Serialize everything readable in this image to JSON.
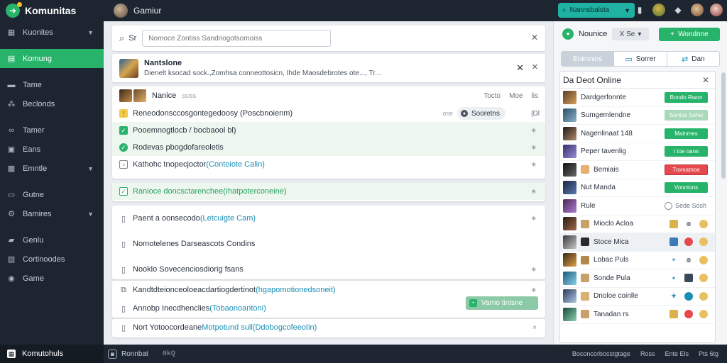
{
  "app": {
    "name": "Komunitas",
    "game_title": "Gamiur"
  },
  "sidebar": {
    "items": [
      {
        "label": "Kuonites",
        "icon": "grid-icon",
        "chevron": true
      },
      {
        "label": "Komung",
        "icon": "list-icon",
        "active": true
      },
      {
        "label": "Tame",
        "icon": "bookmark-icon"
      },
      {
        "label": "Beclonds",
        "icon": "people-icon"
      },
      {
        "label": "Tamer",
        "icon": "link-icon"
      },
      {
        "label": "Eans",
        "icon": "calendar-icon"
      },
      {
        "label": "Emntle",
        "icon": "calendar-check-icon",
        "chevron": true
      },
      {
        "label": "Gutne",
        "icon": "folder-icon"
      },
      {
        "label": "Bamires",
        "icon": "gear-icon",
        "chevron": true
      },
      {
        "label": "Genlu",
        "icon": "image-icon"
      },
      {
        "label": "Cortinoodes",
        "icon": "tag-icon"
      },
      {
        "label": "Game",
        "icon": "globe-icon"
      }
    ],
    "footer_label": "Komutohuls"
  },
  "topbar": {
    "search_pill_label": "Nannsbalsta",
    "icons": [
      "trophy-icon",
      "pin-icon",
      "bell-icon"
    ]
  },
  "filter": {
    "label": "Sr",
    "input_placeholder": "Nomoce Zontiss Sandnogotsomoiss"
  },
  "game_card": {
    "title": "Nantslone",
    "description": "Dienelt ksocad sock.,Zomhsa conneottosicn, Ihde Maosdebrotes ote..., Tr..."
  },
  "thread": {
    "name": "Nanice",
    "sub": "ssiss",
    "meta": [
      "Tocto",
      "Moe",
      "lis"
    ],
    "rows": [
      {
        "mark": "warn",
        "text": "Reneodonsccosgontegedoosy (Poscbnoienm)",
        "chip_left": "ose",
        "chip_label": "Sooretns",
        "chip_right": "|Dl"
      },
      {
        "mark": "ok",
        "text": "Pooemnogtlocb / bocbaool bl)",
        "right": "∗"
      },
      {
        "mark": "okr",
        "text": "Rodevas pbogdofareoletis",
        "right": "∗"
      },
      {
        "mark": "box",
        "text": "Kathohc tnopecjoctor ",
        "link": "(Contoiote Calin)",
        "right": "∗"
      },
      {
        "mark": "gbox",
        "text": "Ranioce doncsctarenchee ",
        "glink": "(Ihatpoterconeine)",
        "right": "∗"
      }
    ]
  },
  "list": {
    "rows": [
      {
        "text": "Paent a oonsecodo ",
        "link": "(Letcuigte Cam)",
        "right": "∗"
      },
      {
        "text": "Nomotelenes Darseascots Condins",
        "right": ""
      },
      {
        "text": "Nooklo Sovecenciosdiorig fsans",
        "right": "∗"
      }
    ]
  },
  "links": {
    "rows": [
      {
        "text": "Kandtdteionceoloeacdartiogdertinot ",
        "link": "(hgapomotionedsoneit)",
        "right": "∗"
      },
      {
        "text": "Annobp Inecdhenclies ",
        "link": "(Tobaonoantoni)"
      }
    ],
    "button_label": "Varno tintsne"
  },
  "last": {
    "text": "Nort Yotoocordeane ",
    "link": "Motpotund sull(Ddobogcofeeotin)",
    "right": "×"
  },
  "right_panel": {
    "head_name": "Nounice",
    "select_label": "X  Se",
    "action_label": "Wondnne",
    "tabs": [
      {
        "label": "Enimnins",
        "icon": ""
      },
      {
        "label": "Sorrer",
        "icon": "monitor-icon"
      },
      {
        "label": "Dan",
        "icon": "share-icon"
      }
    ],
    "online_title": "Da Deot Online",
    "members": [
      {
        "name": "Dardgerfonnte",
        "pill": "g",
        "pill_label": "Bondo Rwon"
      },
      {
        "name": "Sumgemlendne",
        "pill": "lg",
        "pill_label": "Sontos Sohvi"
      },
      {
        "name": "Nagenlinaat 148",
        "pill": "g",
        "pill_label": "Mainmes"
      },
      {
        "name": "Peper tavenlig",
        "pill": "g",
        "pill_label": "I toe oans"
      },
      {
        "name": "Bemiais",
        "pill": "r",
        "pill_label": "Tromatnoe"
      },
      {
        "name": "Nut Manda",
        "pill": "g",
        "pill_label": "Vonntons"
      },
      {
        "name": "Rule",
        "ghost": "Sede Sosh"
      },
      {
        "name": "Mioclo Acloa"
      },
      {
        "name": "Stoce Mica"
      },
      {
        "name": "Lobac Puls"
      },
      {
        "name": "Sonde Pula"
      },
      {
        "name": "Dnoloe coinlle"
      },
      {
        "name": "Tanadan rs"
      }
    ]
  },
  "footer": {
    "label": "Ronnbat",
    "code": "0kQ",
    "right": [
      "Boconcorbosstgtage",
      "Ross",
      "Ente Els",
      "Pts 6tg"
    ]
  }
}
